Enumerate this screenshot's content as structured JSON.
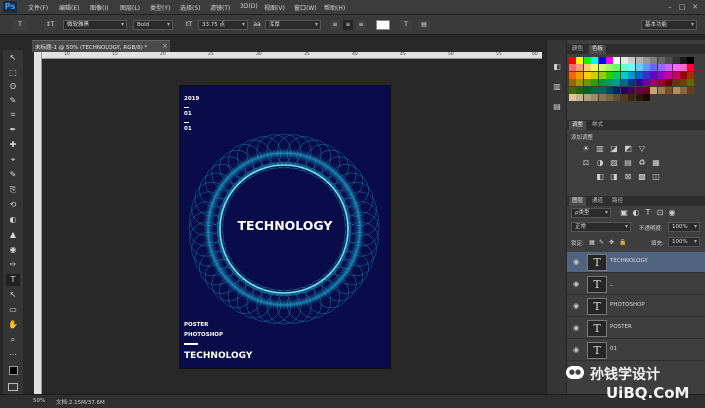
{
  "app": {
    "logo": "Ps"
  },
  "menu": [
    "文件(F)",
    "编辑(E)",
    "图像(I)",
    "图层(L)",
    "类型(Y)",
    "选择(S)",
    "滤镜(T)",
    "3D(D)",
    "视图(V)",
    "窗口(W)",
    "帮助(H)"
  ],
  "window_controls": [
    "–",
    "□",
    "✕"
  ],
  "options": {
    "tool_glyph": "T",
    "orient_glyph": "↕T",
    "font_family": "微软雅黑",
    "font_style": "Bold",
    "size_glyph": "tT",
    "font_size": "33.75 点",
    "aa_glyph": "aa",
    "antialias": "浑厚",
    "align": [
      "≡",
      "≡",
      "≡"
    ],
    "warp_glyph": "T",
    "panel_glyph": "▤",
    "workspace": "基本功能"
  },
  "document": {
    "tab": "未标题-1 @ 50% (TECHNOLOGY, RGB/8) *",
    "close": "×"
  },
  "ruler_top": [
    "10",
    "15",
    "20",
    "25",
    "30",
    "35",
    "40",
    "45",
    "50",
    "55",
    "60"
  ],
  "poster": {
    "year": "2019",
    "line2": "01",
    "line3": "01",
    "title": "TECHNOLOGY",
    "poster": "POSTER",
    "photoshop": "PHOTOSHOP",
    "bottom": "TECHNOLOGY",
    "colors": {
      "bg": "#0a0c4a",
      "ring": "#19d8f0"
    }
  },
  "status": {
    "zoom": "50%",
    "doc": "文档:2.15M/37.6M"
  },
  "panels": {
    "swatch_tabs": [
      "颜色",
      "色板"
    ],
    "swatch_colors": [
      "#ff0000",
      "#ffff00",
      "#00ff00",
      "#00ffff",
      "#0000ff",
      "#ff00ff",
      "#ffffff",
      "#e6e6e6",
      "#cccccc",
      "#b3b3b3",
      "#999999",
      "#808080",
      "#666666",
      "#4d4d4d",
      "#333333",
      "#1a1a1a",
      "#000000",
      "#ff6666",
      "#ff9966",
      "#ffcc66",
      "#ffff66",
      "#ccff66",
      "#99ff66",
      "#66ff66",
      "#66ffcc",
      "#66ffff",
      "#66ccff",
      "#6699ff",
      "#6666ff",
      "#9966ff",
      "#cc66ff",
      "#ff66ff",
      "#ff66cc",
      "#ff0033",
      "#ff6600",
      "#ff9900",
      "#ffcc00",
      "#cccc00",
      "#99cc00",
      "#33cc00",
      "#00cc66",
      "#00cccc",
      "#0099cc",
      "#0066cc",
      "#3333cc",
      "#6600cc",
      "#9900cc",
      "#cc0099",
      "#cc0066",
      "#990000",
      "#993300",
      "#996600",
      "#999900",
      "#669900",
      "#339900",
      "#009933",
      "#009966",
      "#009999",
      "#006699",
      "#003399",
      "#330099",
      "#660099",
      "#990066",
      "#990033",
      "#660000",
      "#663300",
      "#664400",
      "#666600",
      "#446600",
      "#226600",
      "#006622",
      "#006644",
      "#006666",
      "#004466",
      "#002266",
      "#220066",
      "#440066",
      "#660044",
      "#660022",
      "#c8a078",
      "#a07850",
      "#785028",
      "#b48c64",
      "#8c6440",
      "#644020",
      "#dcc8a0",
      "#c8b48c",
      "#b4a078",
      "#a08c64",
      "#8c7850",
      "#786440",
      "#645030",
      "#503c20",
      "#3c2810",
      "#281808",
      "#180c00"
    ],
    "adj_tabs": [
      "调整",
      "样式"
    ],
    "adj_title": "添加调整",
    "adj_row1": [
      "☀",
      "▥",
      "◪",
      "◩",
      "▽"
    ],
    "adj_row2": [
      "⚖",
      "◑",
      "▨",
      "▤",
      "♻",
      "▦"
    ],
    "adj_row3": [
      "◧",
      "◨",
      "⊠",
      "▩",
      "◫"
    ],
    "layer_tabs": [
      "图层",
      "通道",
      "路径"
    ],
    "filter": "ρ类型",
    "filter_icons": [
      "▣",
      "◐",
      "T",
      "⊡",
      "◉"
    ],
    "blend": "正常",
    "opacity_label": "不透明度:",
    "opacity": "100%",
    "lock_label": "锁定:",
    "lock_icons": [
      "▦",
      "✎",
      "✥",
      "🔒"
    ],
    "fill_label": "填充:",
    "fill": "100%",
    "layers": [
      {
        "name": "TECHNOLOGY",
        "selected": true
      },
      {
        "name": "_"
      },
      {
        "name": "PHOTOSHOP"
      },
      {
        "name": "POSTER"
      },
      {
        "name": "01"
      }
    ]
  },
  "dock_icons": [
    "◧",
    "▥",
    "▤"
  ],
  "tools": [
    "↖",
    "⬚",
    "ʘ",
    "✎",
    "⌗",
    "✒",
    "✚",
    "⌖",
    "✎",
    "⎘",
    "⟲",
    "◐",
    "▲",
    "◉",
    "✑",
    "T",
    "↖",
    "▭",
    "✋",
    "⌕",
    "⋯"
  ],
  "watermark": {
    "line1": "孙钱学设计",
    "line2": "UiBQ.CoM"
  }
}
